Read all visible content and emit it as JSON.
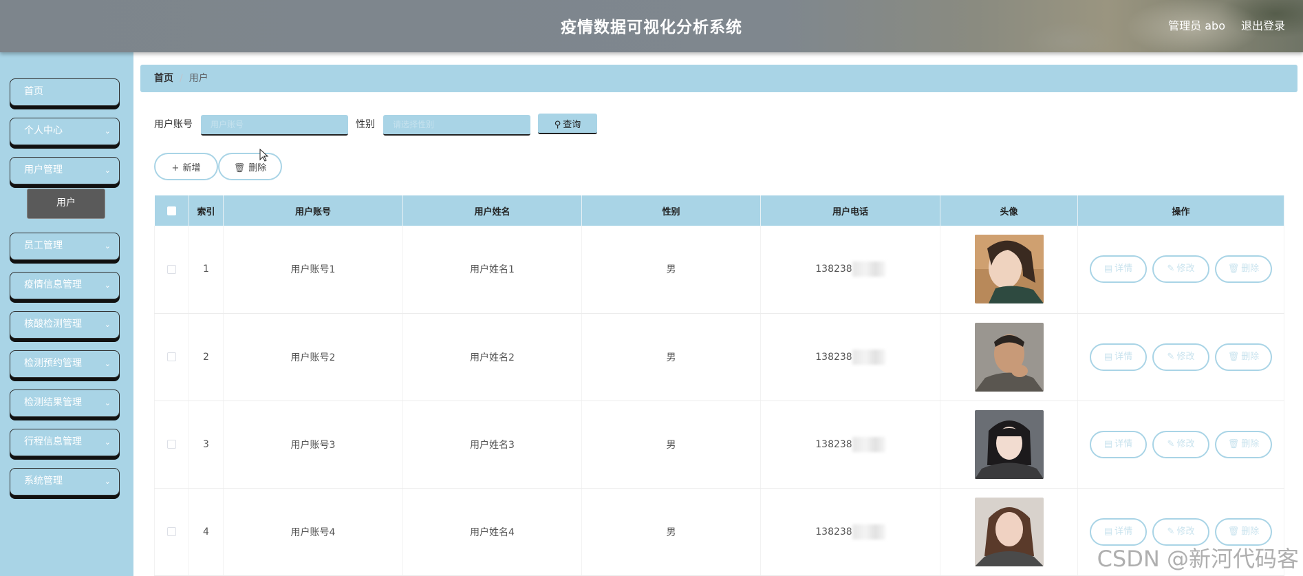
{
  "header": {
    "title": "疫情数据可视化分析系统",
    "admin_label": "管理员 abo",
    "logout_label": "退出登录"
  },
  "sidebar": {
    "items": [
      {
        "label": "首页",
        "has_arrow": false
      },
      {
        "label": "个人中心",
        "has_arrow": true
      },
      {
        "label": "用户管理",
        "has_arrow": true
      },
      {
        "label": "员工管理",
        "has_arrow": true
      },
      {
        "label": "疫情信息管理",
        "has_arrow": true
      },
      {
        "label": "核酸检测管理",
        "has_arrow": true
      },
      {
        "label": "检测预约管理",
        "has_arrow": true
      },
      {
        "label": "检测结果管理",
        "has_arrow": true
      },
      {
        "label": "行程信息管理",
        "has_arrow": true
      },
      {
        "label": "系统管理",
        "has_arrow": true
      }
    ],
    "active_sub": "用户"
  },
  "breadcrumb": {
    "home": "首页",
    "separator": "/",
    "current": "用户"
  },
  "search": {
    "account_label": "用户账号",
    "account_placeholder": "用户账号",
    "gender_label": "性别",
    "gender_placeholder": "请选择性别",
    "query_label": "查询"
  },
  "toolbar": {
    "add_label": "新增",
    "delete_label": "删除"
  },
  "table": {
    "headers": [
      "索引",
      "用户账号",
      "用户姓名",
      "性别",
      "用户电话",
      "头像",
      "操作"
    ],
    "rows": [
      {
        "index": "1",
        "account": "用户账号1",
        "name": "用户姓名1",
        "gender": "男",
        "phone": "138238"
      },
      {
        "index": "2",
        "account": "用户账号2",
        "name": "用户姓名2",
        "gender": "男",
        "phone": "138238"
      },
      {
        "index": "3",
        "account": "用户账号3",
        "name": "用户姓名3",
        "gender": "男",
        "phone": "138238"
      },
      {
        "index": "4",
        "account": "用户账号4",
        "name": "用户姓名4",
        "gender": "男",
        "phone": "138238"
      }
    ],
    "actions": {
      "detail": "详情",
      "edit": "修改",
      "delete": "删除"
    }
  },
  "watermark": "CSDN @新河代码客",
  "colors": {
    "accent": "#a9d4e6",
    "header_bg": "#7d858c",
    "active_sub_bg": "#5a5a5a"
  }
}
